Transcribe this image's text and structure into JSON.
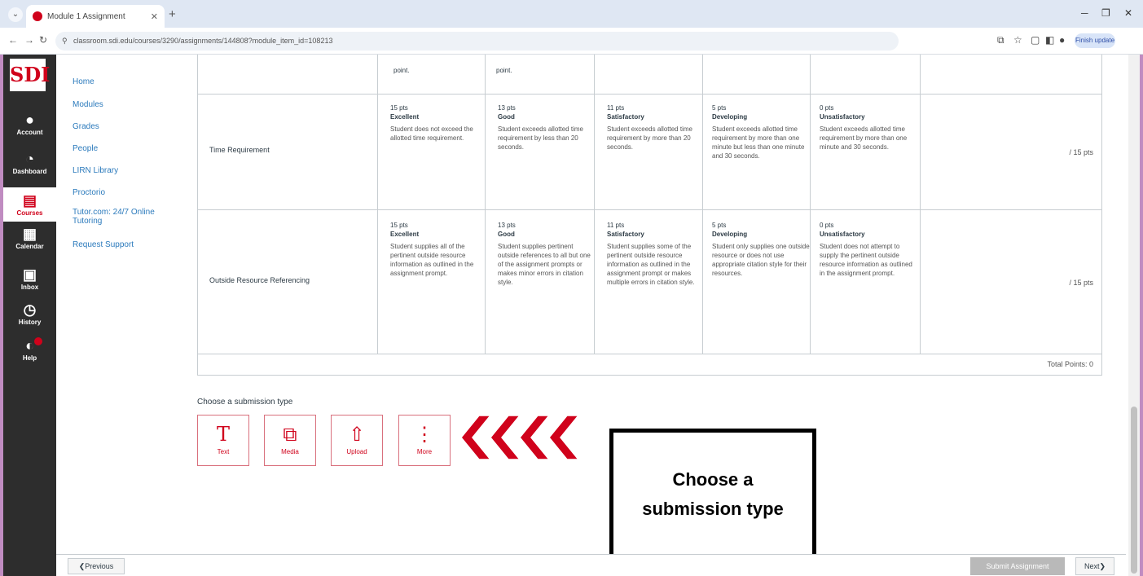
{
  "browser": {
    "tab_title": "Module 1 Assignment",
    "url": "classroom.sdi.edu/courses/3290/assignments/144808?module_item_id=108213",
    "finish_update": "Finish update"
  },
  "global_nav": {
    "logo": "SDI",
    "items": [
      {
        "label": "Account",
        "icon": "user-icon"
      },
      {
        "label": "Dashboard",
        "icon": "dashboard-icon"
      },
      {
        "label": "Courses",
        "icon": "book-icon"
      },
      {
        "label": "Calendar",
        "icon": "calendar-icon"
      },
      {
        "label": "Inbox",
        "icon": "inbox-icon"
      },
      {
        "label": "History",
        "icon": "clock-icon"
      },
      {
        "label": "Help",
        "icon": "help-icon"
      }
    ]
  },
  "course_nav": {
    "items": [
      "Home",
      "Modules",
      "Grades",
      "People",
      "LIRN Library",
      "Proctorio",
      "Tutor.com: 24/7 Online Tutoring",
      "Request Support"
    ]
  },
  "rubric": {
    "top_row_fragments": [
      "point.",
      "point."
    ],
    "rows": [
      {
        "criterion": "Time Requirement",
        "points": "/ 15 pts",
        "ratings": [
          {
            "pts": "15 pts",
            "label": "Excellent",
            "desc": "Student does not exceed the allotted time requirement."
          },
          {
            "pts": "13 pts",
            "label": "Good",
            "desc": "Student exceeds allotted time requirement by less than 20 seconds."
          },
          {
            "pts": "11 pts",
            "label": "Satisfactory",
            "desc": "Student exceeds allotted time requirement by more than 20 seconds."
          },
          {
            "pts": "5 pts",
            "label": "Developing",
            "desc": "Student exceeds allotted time requirement by more than one minute but less than one minute and 30 seconds."
          },
          {
            "pts": "0 pts",
            "label": "Unsatisfactory",
            "desc": "Student exceeds allotted time requirement by more than one minute and 30 seconds."
          }
        ]
      },
      {
        "criterion": "Outside Resource Referencing",
        "points": "/ 15 pts",
        "ratings": [
          {
            "pts": "15 pts",
            "label": "Excellent",
            "desc": "Student supplies all of the pertinent outside resource information as outlined in the assignment prompt."
          },
          {
            "pts": "13 pts",
            "label": "Good",
            "desc": "Student supplies pertinent outside references to all but one of the assignment prompts or makes minor errors in citation style."
          },
          {
            "pts": "11 pts",
            "label": "Satisfactory",
            "desc": "Student supplies some of the pertinent outside resource information as outlined in the assignment prompt or makes multiple errors in citation style."
          },
          {
            "pts": "5 pts",
            "label": "Developing",
            "desc": "Student only supplies one outside resource or does not use appropriate citation style for their resources."
          },
          {
            "pts": "0 pts",
            "label": "Unsatisfactory",
            "desc": "Student does not attempt to supply the pertinent outside resource information as outlined in the assignment prompt."
          }
        ]
      }
    ],
    "total": "Total Points: 0"
  },
  "submission": {
    "heading": "Choose a submission type",
    "types": [
      {
        "label": "Text",
        "icon": "T"
      },
      {
        "label": "Media",
        "icon": "⧉"
      },
      {
        "label": "Upload",
        "icon": "⇧"
      },
      {
        "label": "More",
        "icon": "⋮"
      }
    ]
  },
  "callout": {
    "text": "Choose a submission type"
  },
  "footer": {
    "previous": "❮Previous",
    "submit": "Submit Assignment",
    "next": "Next❯"
  },
  "colors": {
    "accent": "#d0021b",
    "nav_bg": "#2d2d2d",
    "link": "#2b7abc"
  }
}
